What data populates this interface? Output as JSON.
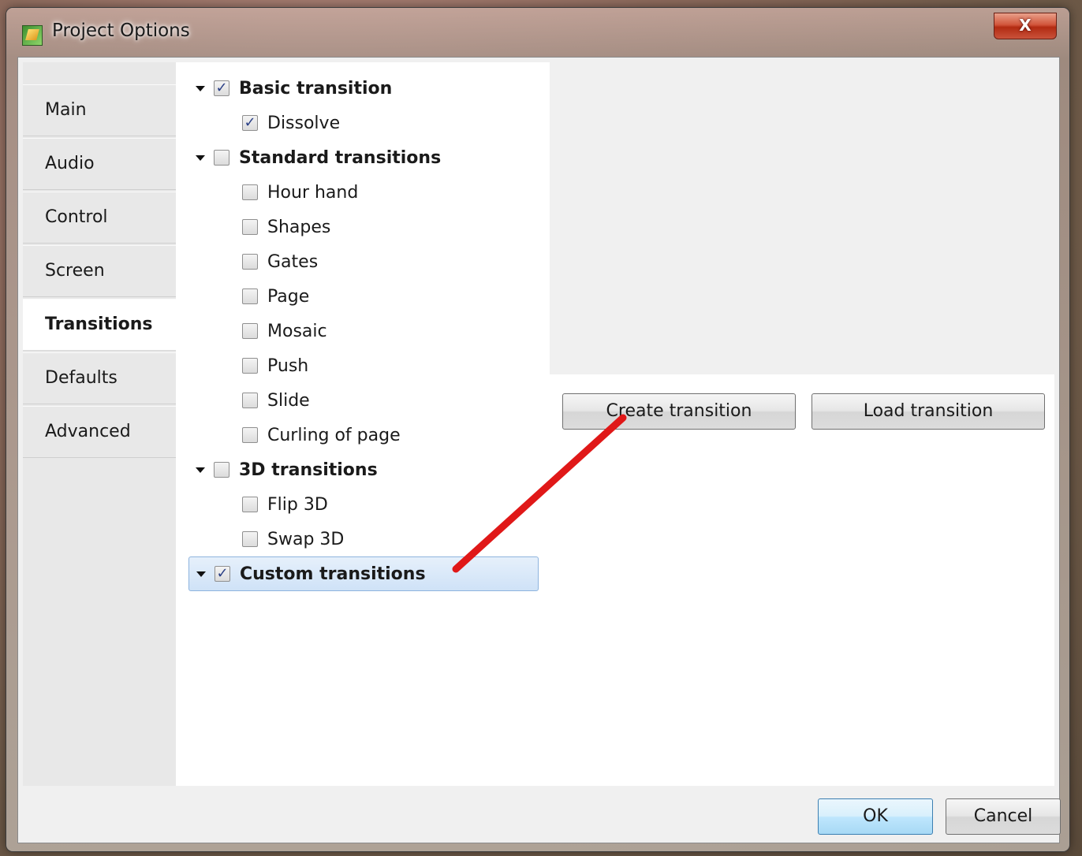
{
  "window": {
    "title": "Project Options",
    "close_label": "X"
  },
  "tabs": [
    {
      "label": "Main",
      "active": false
    },
    {
      "label": "Audio",
      "active": false
    },
    {
      "label": "Control",
      "active": false
    },
    {
      "label": "Screen",
      "active": false
    },
    {
      "label": "Transitions",
      "active": true
    },
    {
      "label": "Defaults",
      "active": false
    },
    {
      "label": "Advanced",
      "active": false
    }
  ],
  "tree": [
    {
      "label": "Basic transition",
      "group": true,
      "checked": true,
      "expanded": true
    },
    {
      "label": "Dissolve",
      "group": false,
      "checked": true
    },
    {
      "label": "Standard transitions",
      "group": true,
      "checked": false,
      "expanded": true
    },
    {
      "label": "Hour hand",
      "group": false,
      "checked": false
    },
    {
      "label": "Shapes",
      "group": false,
      "checked": false
    },
    {
      "label": "Gates",
      "group": false,
      "checked": false
    },
    {
      "label": "Page",
      "group": false,
      "checked": false
    },
    {
      "label": "Mosaic",
      "group": false,
      "checked": false
    },
    {
      "label": "Push",
      "group": false,
      "checked": false
    },
    {
      "label": "Slide",
      "group": false,
      "checked": false
    },
    {
      "label": "Curling of page",
      "group": false,
      "checked": false
    },
    {
      "label": "3D transitions",
      "group": true,
      "checked": false,
      "expanded": true
    },
    {
      "label": "Flip 3D",
      "group": false,
      "checked": false
    },
    {
      "label": "Swap 3D",
      "group": false,
      "checked": false
    },
    {
      "label": "Custom transitions",
      "group": true,
      "checked": true,
      "expanded": true,
      "selected": true
    }
  ],
  "actions": {
    "create_label": "Create transition",
    "load_label": "Load transition"
  },
  "footer": {
    "ok_label": "OK",
    "cancel_label": "Cancel"
  },
  "colors": {
    "annotation_arrow": "#e01818",
    "selection": "#cfe2f7",
    "default_button": "#bee6fd"
  }
}
